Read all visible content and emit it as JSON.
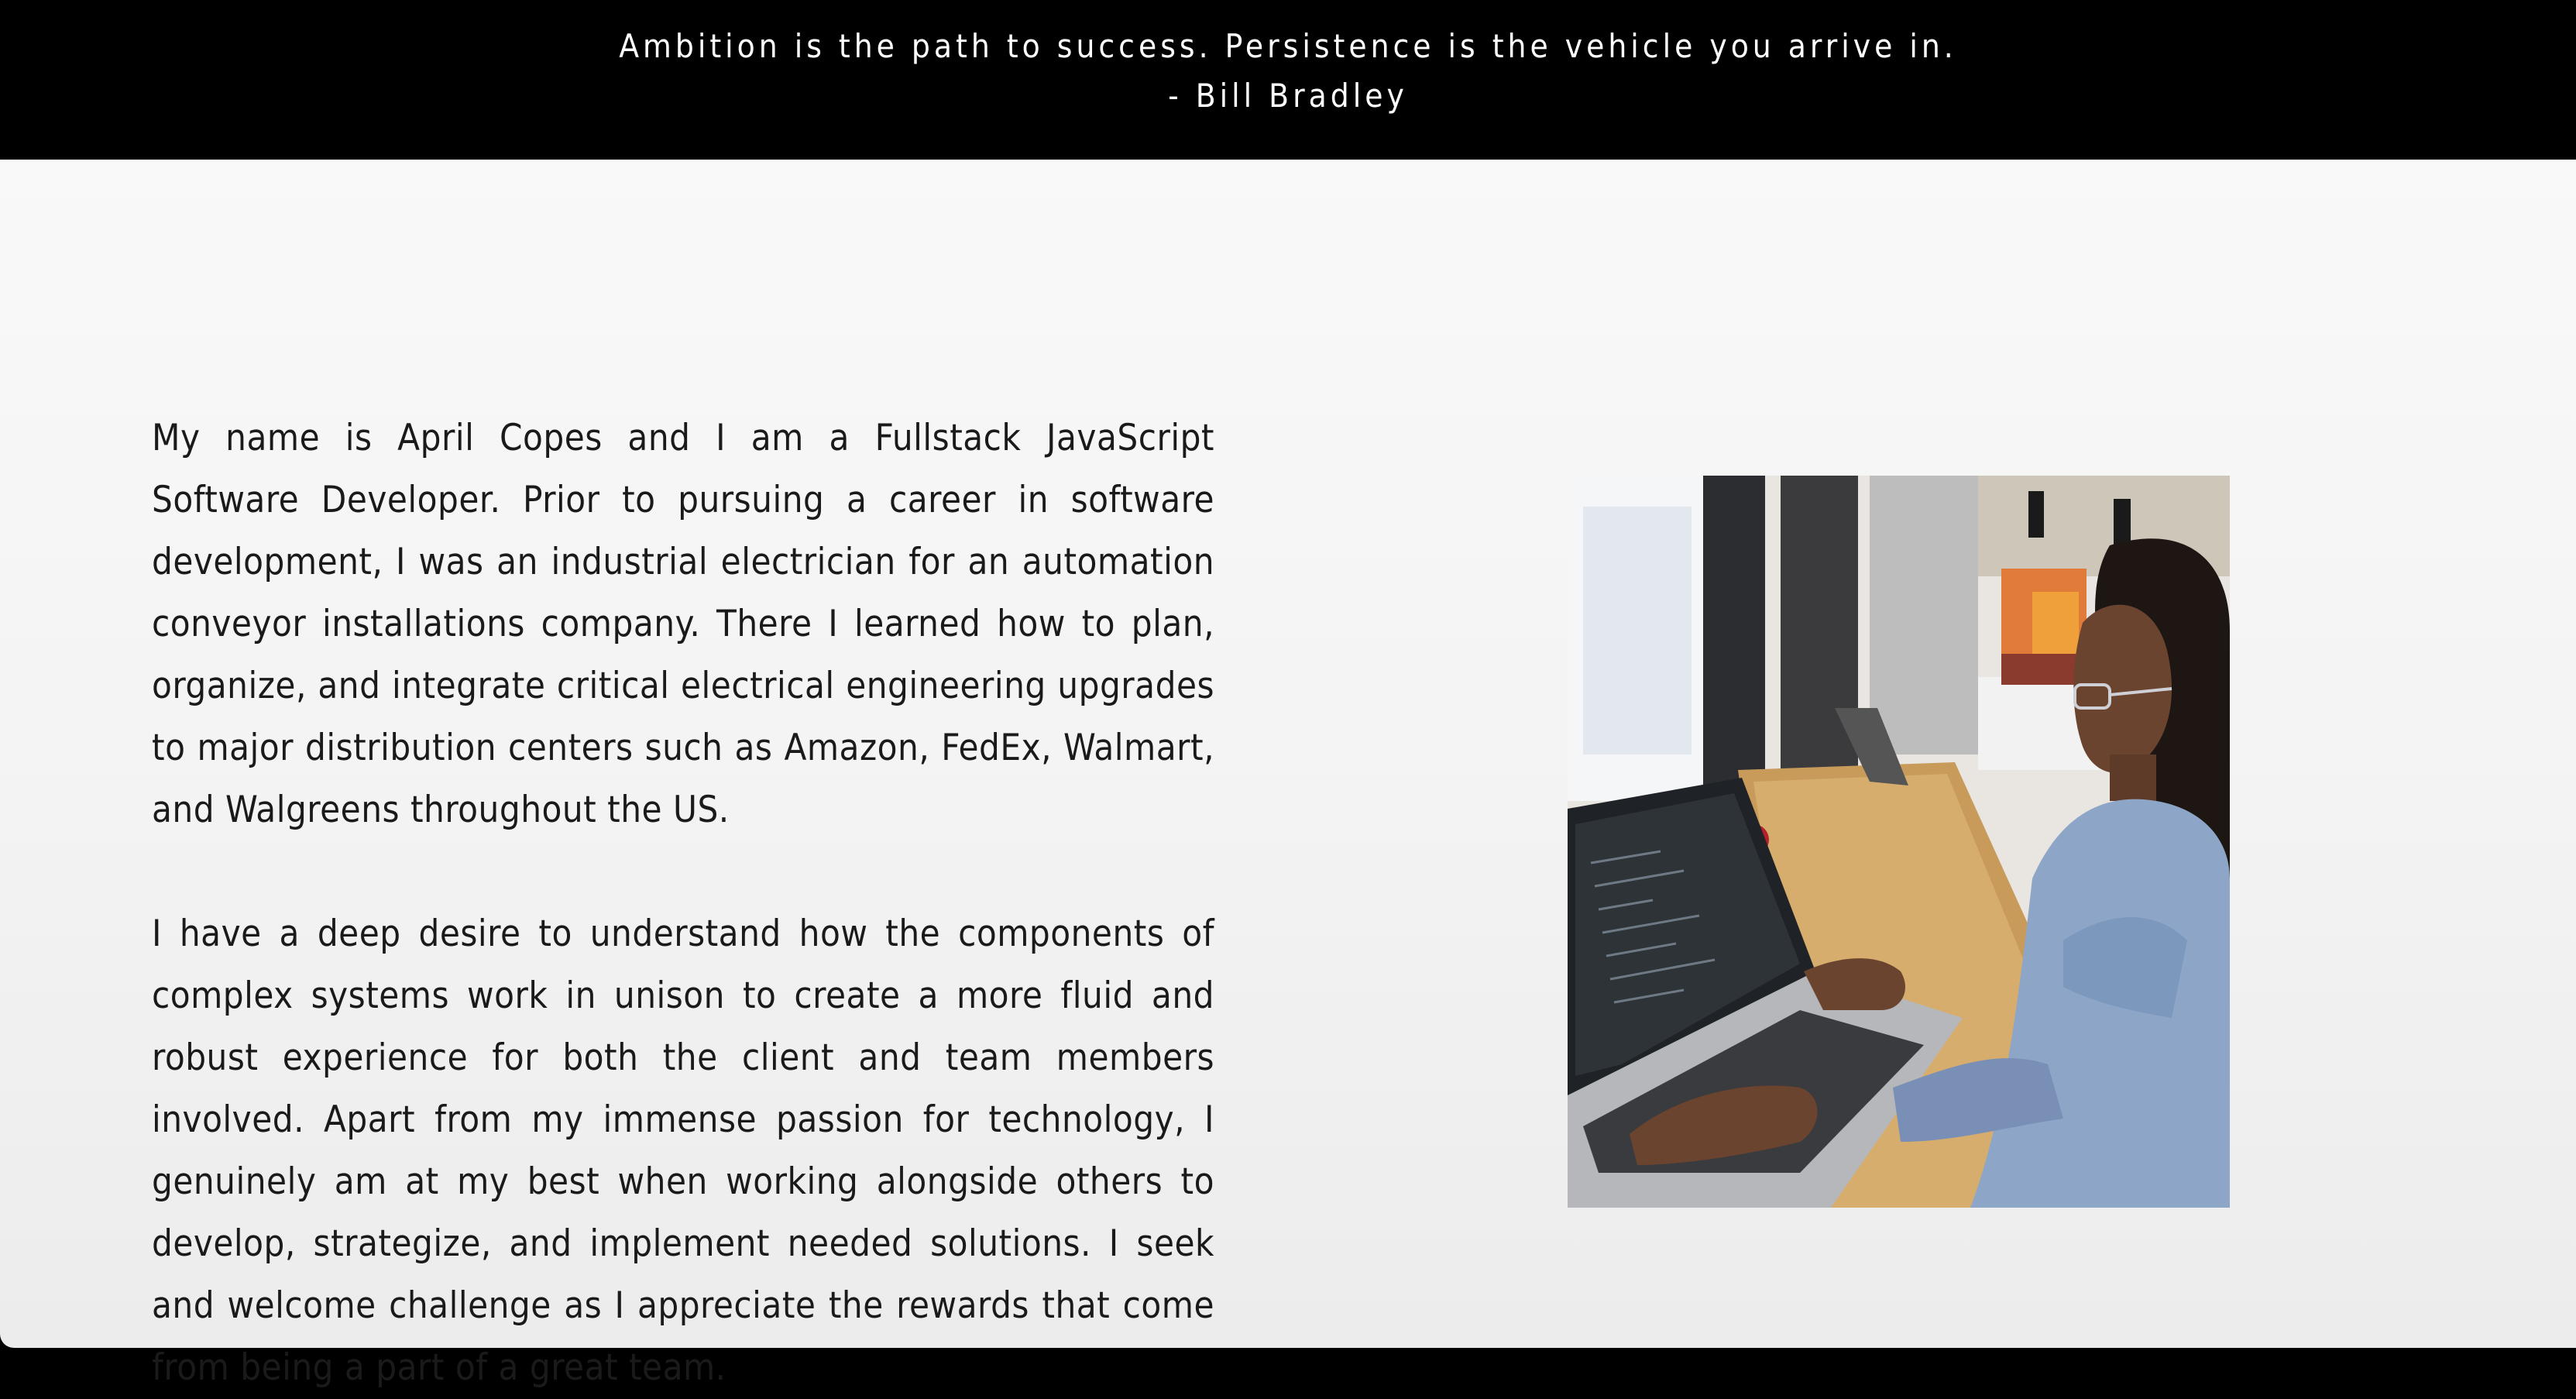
{
  "quote": {
    "text": "Ambition is the path to success. Persistence is the vehicle you arrive in.",
    "author": "- Bill Bradley"
  },
  "about": {
    "paragraph_1": "My name is April Copes and I am a Fullstack JavaScript Software Developer. Prior to pursuing a career in software development, I was an industrial electrician for an automation conveyor installations company. There I learned how to plan, organize, and integrate critical electrical engineering upgrades to major distribution centers such as Amazon, FedEx, Walmart, and Walgreens throughout the US.",
    "paragraph_2": "I have a deep desire to understand how the components of complex systems work in unison to create a more fluid and robust experience for both the client and team members involved. Apart from my immense passion for technology, I genuinely am at my best when working alongside others to develop, strategize, and implement needed solutions. I seek and welcome challenge as I appreciate the rewards that come from being a part of a great team."
  },
  "colors": {
    "banner_background": "#000000",
    "banner_text": "#ffffff",
    "body_text": "#1a1a1a"
  }
}
